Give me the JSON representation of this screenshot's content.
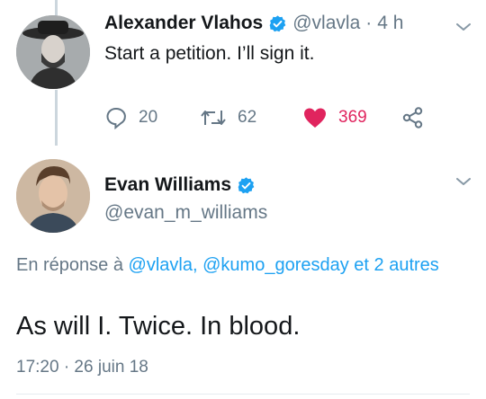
{
  "tweet1": {
    "name": "Alexander Vlahos",
    "handle": "@vlavla",
    "separator": "·",
    "time": "4 h",
    "text": "Start a petition. I’ll sign it.",
    "replies": "20",
    "retweets": "62",
    "likes": "369"
  },
  "tweet2": {
    "name": "Evan Williams",
    "handle": "@evan_m_williams",
    "reply_prefix": "En réponse à",
    "mention1": "@vlavla,",
    "mention2": "@kumo_goresday",
    "reply_suffix": "et 2 autres",
    "text": "As will I. Twice. In blood.",
    "timestamp": "17:20 · 26 juin 18"
  },
  "colors": {
    "accent": "#1da1f2",
    "like": "#e0245e",
    "muted": "#657786",
    "text": "#14171a"
  },
  "icons": [
    "verified-icon",
    "chevron-down-icon",
    "reply-icon",
    "retweet-icon",
    "heart-icon",
    "share-icon"
  ]
}
